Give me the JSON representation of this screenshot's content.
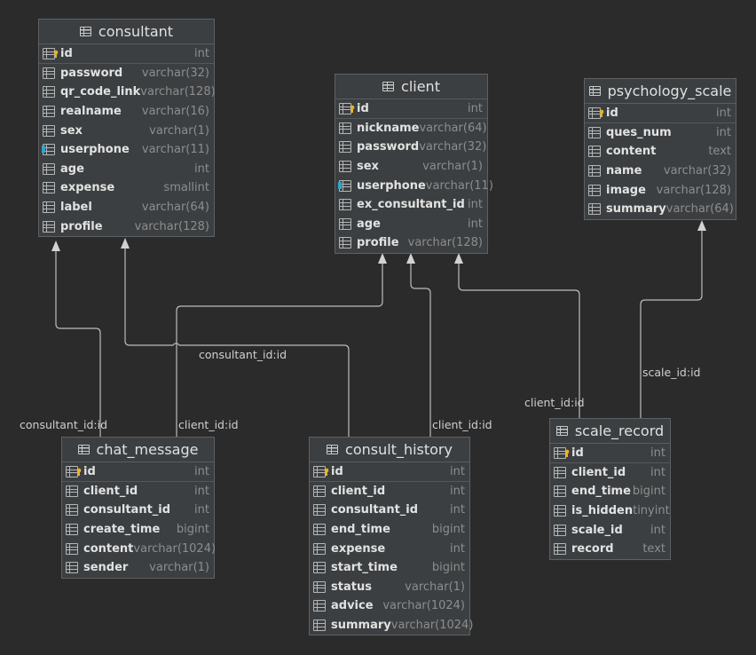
{
  "tables": {
    "consultant": {
      "name": "consultant",
      "columns": [
        {
          "name": "id",
          "type": "int",
          "icon": "primary-key"
        },
        {
          "name": "password",
          "type": "varchar(32)",
          "icon": "column"
        },
        {
          "name": "qr_code_link",
          "type": "varchar(128)",
          "icon": "column"
        },
        {
          "name": "realname",
          "type": "varchar(16)",
          "icon": "column"
        },
        {
          "name": "sex",
          "type": "varchar(1)",
          "icon": "column"
        },
        {
          "name": "userphone",
          "type": "varchar(11)",
          "icon": "indexed-column"
        },
        {
          "name": "age",
          "type": "int",
          "icon": "column"
        },
        {
          "name": "expense",
          "type": "smallint",
          "icon": "column"
        },
        {
          "name": "label",
          "type": "varchar(64)",
          "icon": "column"
        },
        {
          "name": "profile",
          "type": "varchar(128)",
          "icon": "column"
        }
      ]
    },
    "client": {
      "name": "client",
      "columns": [
        {
          "name": "id",
          "type": "int",
          "icon": "primary-key"
        },
        {
          "name": "nickname",
          "type": "varchar(64)",
          "icon": "column"
        },
        {
          "name": "password",
          "type": "varchar(32)",
          "icon": "column"
        },
        {
          "name": "sex",
          "type": "varchar(1)",
          "icon": "column"
        },
        {
          "name": "userphone",
          "type": "varchar(11)",
          "icon": "indexed-column"
        },
        {
          "name": "ex_consultant_id",
          "type": "int",
          "icon": "column"
        },
        {
          "name": "age",
          "type": "int",
          "icon": "column"
        },
        {
          "name": "profile",
          "type": "varchar(128)",
          "icon": "column"
        }
      ]
    },
    "psychology_scale": {
      "name": "psychology_scale",
      "columns": [
        {
          "name": "id",
          "type": "int",
          "icon": "primary-key"
        },
        {
          "name": "ques_num",
          "type": "int",
          "icon": "column"
        },
        {
          "name": "content",
          "type": "text",
          "icon": "column"
        },
        {
          "name": "name",
          "type": "varchar(32)",
          "icon": "column"
        },
        {
          "name": "image",
          "type": "varchar(128)",
          "icon": "column"
        },
        {
          "name": "summary",
          "type": "varchar(64)",
          "icon": "column"
        }
      ]
    },
    "chat_message": {
      "name": "chat_message",
      "columns": [
        {
          "name": "id",
          "type": "int",
          "icon": "primary-key"
        },
        {
          "name": "client_id",
          "type": "int",
          "icon": "column"
        },
        {
          "name": "consultant_id",
          "type": "int",
          "icon": "column"
        },
        {
          "name": "create_time",
          "type": "bigint",
          "icon": "column"
        },
        {
          "name": "content",
          "type": "varchar(1024)",
          "icon": "column"
        },
        {
          "name": "sender",
          "type": "varchar(1)",
          "icon": "column"
        }
      ]
    },
    "consult_history": {
      "name": "consult_history",
      "columns": [
        {
          "name": "id",
          "type": "int",
          "icon": "primary-key"
        },
        {
          "name": "client_id",
          "type": "int",
          "icon": "column"
        },
        {
          "name": "consultant_id",
          "type": "int",
          "icon": "column"
        },
        {
          "name": "end_time",
          "type": "bigint",
          "icon": "column"
        },
        {
          "name": "expense",
          "type": "int",
          "icon": "column"
        },
        {
          "name": "start_time",
          "type": "bigint",
          "icon": "column"
        },
        {
          "name": "status",
          "type": "varchar(1)",
          "icon": "column"
        },
        {
          "name": "advice",
          "type": "varchar(1024)",
          "icon": "column"
        },
        {
          "name": "summary",
          "type": "varchar(1024)",
          "icon": "column"
        }
      ]
    },
    "scale_record": {
      "name": "scale_record",
      "columns": [
        {
          "name": "id",
          "type": "int",
          "icon": "primary-key"
        },
        {
          "name": "client_id",
          "type": "int",
          "icon": "column"
        },
        {
          "name": "end_time",
          "type": "bigint",
          "icon": "column"
        },
        {
          "name": "is_hidden",
          "type": "tinyint",
          "icon": "column"
        },
        {
          "name": "scale_id",
          "type": "int",
          "icon": "column"
        },
        {
          "name": "record",
          "type": "text",
          "icon": "column"
        }
      ]
    }
  },
  "relations": [
    {
      "id": "chat-consultant",
      "from": "chat_message",
      "to": "consultant",
      "label": "consultant_id:id"
    },
    {
      "id": "chat-client",
      "from": "chat_message",
      "to": "client",
      "label": "client_id:id"
    },
    {
      "id": "history-consultant",
      "from": "consult_history",
      "to": "consultant",
      "label": "consultant_id:id"
    },
    {
      "id": "history-client",
      "from": "consult_history",
      "to": "client",
      "label": "client_id:id"
    },
    {
      "id": "record-client",
      "from": "scale_record",
      "to": "client",
      "label": "client_id:id"
    },
    {
      "id": "record-scale",
      "from": "scale_record",
      "to": "psychology_scale",
      "label": "scale_id:id"
    }
  ],
  "colors": {
    "background": "#2b2b2b",
    "table_fill": "#3c3f41",
    "table_border": "#5e6163",
    "line": "#bcbcbc",
    "key_icon": "#e6b422",
    "index_marker": "#3aa1c4"
  }
}
